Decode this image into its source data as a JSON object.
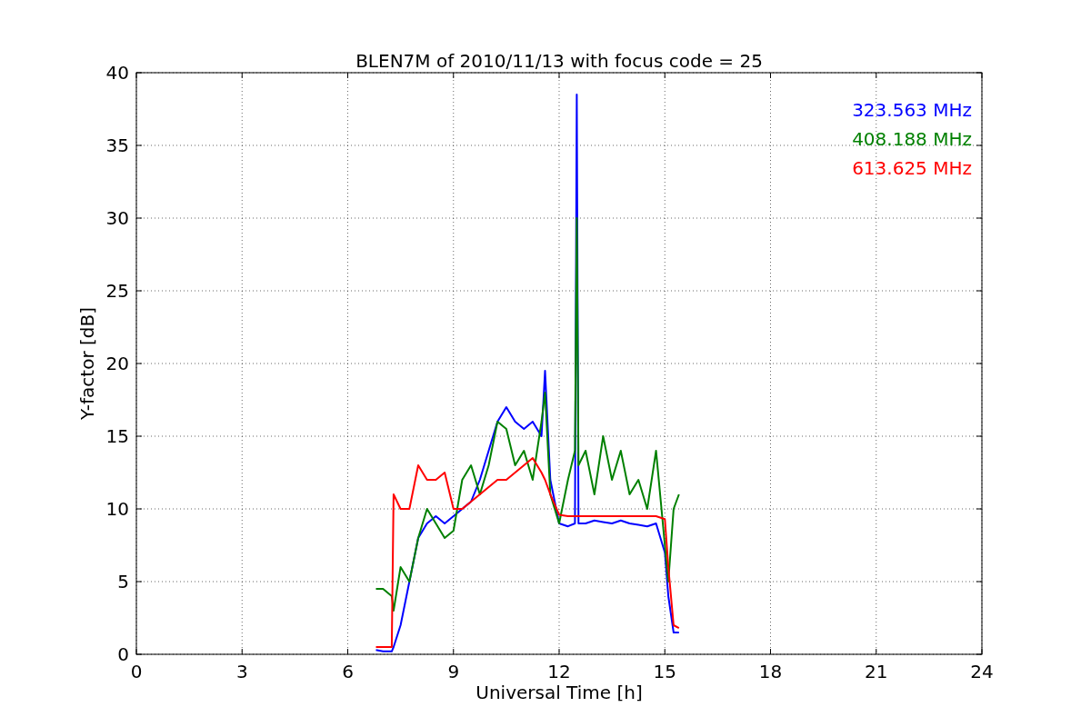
{
  "chart_data": {
    "type": "line",
    "title": "BLEN7M of 2010/11/13 with focus code = 25",
    "xlabel": "Universal Time [h]",
    "ylabel": "Y-factor [dB]",
    "x": [
      6.8,
      7.0,
      7.25,
      7.3,
      7.5,
      7.75,
      8.0,
      8.25,
      8.5,
      8.75,
      9.0,
      9.25,
      9.5,
      9.75,
      10.0,
      10.25,
      10.5,
      10.75,
      11.0,
      11.25,
      11.5,
      11.6,
      11.75,
      12.0,
      12.25,
      12.45,
      12.5,
      12.55,
      12.75,
      13.0,
      13.25,
      13.5,
      13.75,
      14.0,
      14.25,
      14.5,
      14.75,
      15.0,
      15.1,
      15.25,
      15.4
    ],
    "series": [
      {
        "name": "323.563 MHz",
        "color": "#0000ff",
        "values": [
          0.3,
          0.2,
          0.2,
          0.5,
          2,
          5,
          8,
          9,
          9.5,
          9,
          9.5,
          10,
          10.5,
          12,
          14,
          16,
          17,
          16,
          15.5,
          16,
          15,
          19.5,
          12,
          9,
          8.8,
          9,
          38.5,
          9,
          9,
          9.2,
          9.1,
          9,
          9.2,
          9,
          8.9,
          8.8,
          9,
          7,
          4,
          1.5,
          1.5
        ]
      },
      {
        "name": "408.188 MHz",
        "color": "#008000",
        "values": [
          4.5,
          4.5,
          4,
          3,
          6,
          5,
          8,
          10,
          9,
          8,
          8.5,
          12,
          13,
          11,
          13,
          16,
          15.5,
          13,
          14,
          12,
          16,
          18,
          11,
          9,
          12,
          14,
          30,
          13,
          14,
          11,
          15,
          12,
          14,
          11,
          12,
          10,
          14,
          7.5,
          5,
          10,
          11
        ]
      },
      {
        "name": "613.625 MHz",
        "color": "#ff0000",
        "values": [
          0.5,
          0.5,
          0.5,
          11,
          10,
          10,
          13,
          12,
          12,
          12.5,
          10,
          10,
          10.5,
          11,
          11.5,
          12,
          12,
          12.5,
          13,
          13.5,
          12.5,
          12,
          11,
          9.6,
          9.5,
          9.5,
          9.5,
          9.5,
          9.5,
          9.5,
          9.5,
          9.5,
          9.5,
          9.5,
          9.5,
          9.5,
          9.5,
          9.3,
          6,
          2,
          1.8
        ]
      }
    ],
    "grid": true,
    "xlim": [
      0,
      24
    ],
    "ylim": [
      0,
      40
    ],
    "xticks": [
      0,
      3,
      6,
      9,
      12,
      15,
      18,
      21,
      24
    ],
    "yticks": [
      0,
      5,
      10,
      15,
      20,
      25,
      30,
      35,
      40
    ]
  }
}
